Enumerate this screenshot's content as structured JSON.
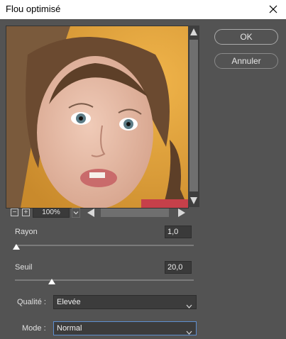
{
  "window": {
    "title": "Flou optimisé"
  },
  "actions": {
    "ok_label": "OK",
    "cancel_label": "Annuler"
  },
  "preview": {
    "zoom": "100%"
  },
  "rayon": {
    "label": "Rayon",
    "value": "1,0",
    "level": 0.0
  },
  "seuil": {
    "label": "Seuil",
    "value": "20,0",
    "level": 0.2
  },
  "qualite": {
    "label": "Qualité :",
    "value": "Elevée"
  },
  "mode": {
    "label": "Mode :",
    "value": "Normal"
  }
}
